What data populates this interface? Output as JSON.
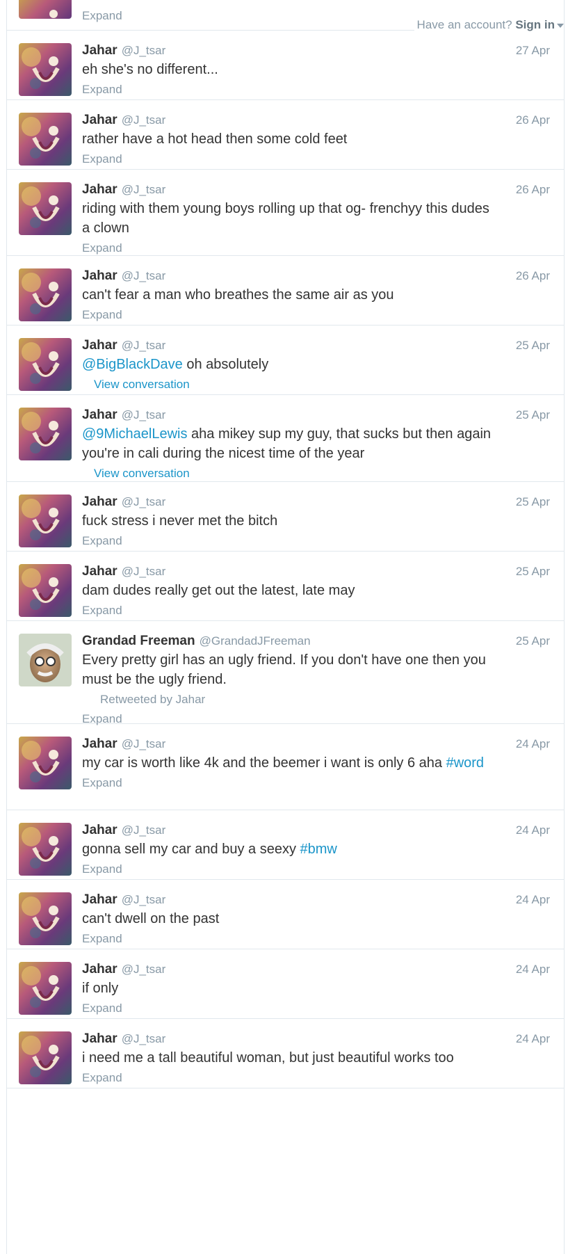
{
  "header": {
    "have_account": "Have an account?",
    "sign_in": "Sign in"
  },
  "top_partial": {
    "expand": "Expand"
  },
  "tweets": [
    {
      "name": "Jahar",
      "handle": "@J_tsar",
      "time": "27 Apr",
      "text": "eh she's no different...",
      "action": "Expand"
    },
    {
      "name": "Jahar",
      "handle": "@J_tsar",
      "time": "26 Apr",
      "text": "rather have a hot head then some cold feet",
      "action": "Expand"
    },
    {
      "name": "Jahar",
      "handle": "@J_tsar",
      "time": "26 Apr",
      "text": "riding with them young boys rolling up that og- frenchyy this dudes a clown",
      "action": "Expand"
    },
    {
      "name": "Jahar",
      "handle": "@J_tsar",
      "time": "26 Apr",
      "text": "can't fear a man who breathes the same air as you",
      "action": "Expand"
    },
    {
      "name": "Jahar",
      "handle": "@J_tsar",
      "time": "25 Apr",
      "mention": "@BigBlackDave",
      "text": " oh absolutely",
      "action": "View conversation"
    },
    {
      "name": "Jahar",
      "handle": "@J_tsar",
      "time": "25 Apr",
      "mention": "@9MichaelLewis",
      "text": " aha mikey sup my guy, that sucks but then again you're in cali during the nicest time of the year",
      "action": "View conversation"
    },
    {
      "name": "Jahar",
      "handle": "@J_tsar",
      "time": "25 Apr",
      "text": "fuck stress i never met the bitch",
      "action": "Expand"
    },
    {
      "name": "Jahar",
      "handle": "@J_tsar",
      "time": "25 Apr",
      "text": "dam dudes really get out the latest, late may",
      "action": "Expand"
    },
    {
      "name": "Grandad Freeman",
      "handle": "@GrandadJFreeman",
      "time": "25 Apr",
      "text": "Every pretty girl has an ugly friend. If you don't have one then you must be the ugly friend.",
      "retweeted": "Retweeted by Jahar",
      "action": "Expand"
    },
    {
      "name": "Jahar",
      "handle": "@J_tsar",
      "time": "24 Apr",
      "text": "my car is worth like 4k and the beemer i want is only 6 aha ",
      "hashtag": "#word",
      "action": "Expand"
    },
    {
      "name": "Jahar",
      "handle": "@J_tsar",
      "time": "24 Apr",
      "text": "gonna sell my car and buy a seexy ",
      "hashtag": "#bmw",
      "action": "Expand"
    },
    {
      "name": "Jahar",
      "handle": "@J_tsar",
      "time": "24 Apr",
      "text": "can't dwell on the past",
      "action": "Expand"
    },
    {
      "name": "Jahar",
      "handle": "@J_tsar",
      "time": "24 Apr",
      "text": "if only",
      "action": "Expand"
    },
    {
      "name": "Jahar",
      "handle": "@J_tsar",
      "time": "24 Apr",
      "text": "i need me a tall beautiful woman, but just beautiful works too",
      "action": "Expand"
    }
  ]
}
